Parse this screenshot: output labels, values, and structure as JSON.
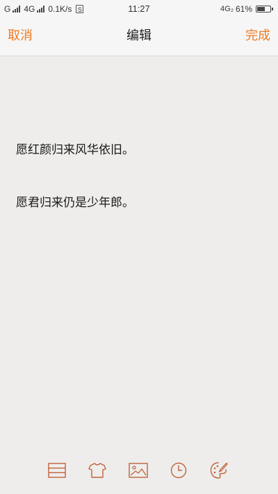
{
  "status_bar": {
    "carrier_1": "G",
    "carrier_2": "4G",
    "speed": "0.1K/s",
    "sim_label": "S",
    "time": "11:27",
    "network": "4G₂",
    "battery_percent": "61%",
    "battery_level": 0.61
  },
  "nav": {
    "cancel": "取消",
    "title": "编辑",
    "done": "完成"
  },
  "editor": {
    "lines": [
      "愿红颜归来风华依旧。",
      "愿君归来仍是少年郎。"
    ]
  },
  "toolbar": {
    "items": [
      {
        "icon": "list-format-icon"
      },
      {
        "icon": "tshirt-icon"
      },
      {
        "icon": "image-icon"
      },
      {
        "icon": "clock-icon"
      },
      {
        "icon": "palette-icon"
      }
    ]
  },
  "colors": {
    "accent": "#f07a22",
    "icon": "#c0623a",
    "background": "#eeedeb",
    "bar": "#f6f6f6",
    "text": "#1a1a1a"
  }
}
